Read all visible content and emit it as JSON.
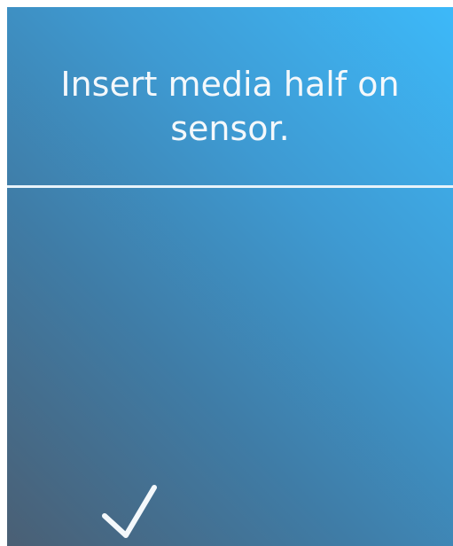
{
  "prompt": {
    "text": "Insert media half on sensor."
  },
  "actions": {
    "confirm_icon": "checkmark-icon"
  },
  "colors": {
    "gradient_top_right": "#3db9f9",
    "gradient_bottom_left": "#4a5f74",
    "foreground": "#f4f8fb"
  }
}
